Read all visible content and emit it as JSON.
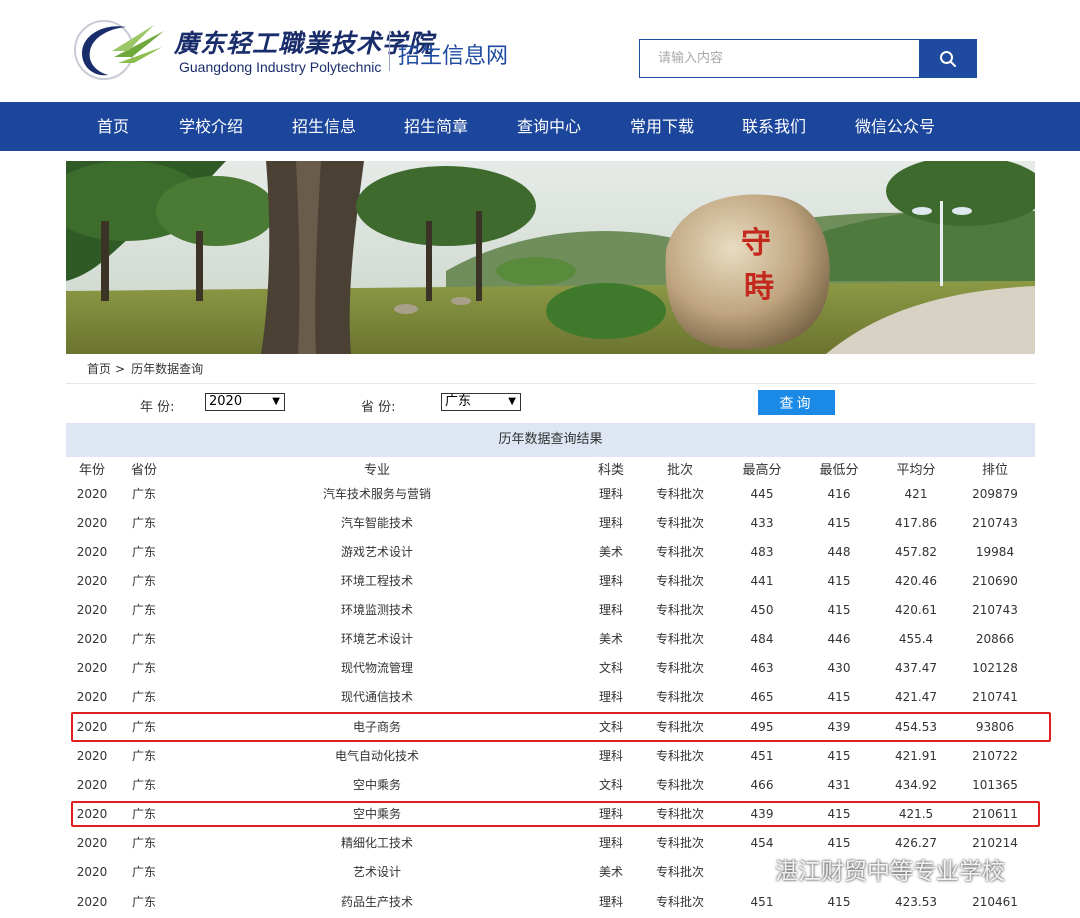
{
  "header": {
    "logo_cn": "廣东轻工職業技术学院",
    "logo_en": "Guangdong Industry Polytechnic",
    "site_name": "招生信息网",
    "search_placeholder": "请输入内容",
    "search_icon": "search-icon",
    "accent": "#1e4aa0"
  },
  "nav": {
    "items": [
      "首页",
      "学校介绍",
      "招生信息",
      "招生简章",
      "查询中心",
      "常用下载",
      "联系我们",
      "微信公众号"
    ],
    "bg": "#1b469c"
  },
  "banner": {
    "stone_text_1": "守",
    "stone_text_2": "時"
  },
  "breadcrumb": {
    "home": "首页",
    "separator": ">",
    "current": "历年数据查询"
  },
  "filters": {
    "year_label": "年  份:",
    "year_value": "2020",
    "province_label": "省  份:",
    "province_value": "广东",
    "query_button": "查询"
  },
  "results": {
    "title": "历年数据查询结果",
    "columns": [
      "年份",
      "省份",
      "专业",
      "科类",
      "批次",
      "最高分",
      "最低分",
      "平均分",
      "排位"
    ],
    "rows": [
      [
        "2020",
        "广东",
        "汽车技术服务与营销",
        "理科",
        "专科批次",
        "445",
        "416",
        "421",
        "209879"
      ],
      [
        "2020",
        "广东",
        "汽车智能技术",
        "理科",
        "专科批次",
        "433",
        "415",
        "417.86",
        "210743"
      ],
      [
        "2020",
        "广东",
        "游戏艺术设计",
        "美术",
        "专科批次",
        "483",
        "448",
        "457.82",
        "19984"
      ],
      [
        "2020",
        "广东",
        "环境工程技术",
        "理科",
        "专科批次",
        "441",
        "415",
        "420.46",
        "210690"
      ],
      [
        "2020",
        "广东",
        "环境监测技术",
        "理科",
        "专科批次",
        "450",
        "415",
        "420.61",
        "210743"
      ],
      [
        "2020",
        "广东",
        "环境艺术设计",
        "美术",
        "专科批次",
        "484",
        "446",
        "455.4",
        "20866"
      ],
      [
        "2020",
        "广东",
        "现代物流管理",
        "文科",
        "专科批次",
        "463",
        "430",
        "437.47",
        "102128"
      ],
      [
        "2020",
        "广东",
        "现代通信技术",
        "理科",
        "专科批次",
        "465",
        "415",
        "421.47",
        "210741"
      ],
      [
        "2020",
        "广东",
        "电子商务",
        "文科",
        "专科批次",
        "495",
        "439",
        "454.53",
        "93806"
      ],
      [
        "2020",
        "广东",
        "电气自动化技术",
        "理科",
        "专科批次",
        "451",
        "415",
        "421.91",
        "210722"
      ],
      [
        "2020",
        "广东",
        "空中乘务",
        "文科",
        "专科批次",
        "466",
        "431",
        "434.92",
        "101365"
      ],
      [
        "2020",
        "广东",
        "空中乘务",
        "理科",
        "专科批次",
        "439",
        "415",
        "421.5",
        "210611"
      ],
      [
        "2020",
        "广东",
        "精细化工技术",
        "理科",
        "专科批次",
        "454",
        "415",
        "426.27",
        "210214"
      ],
      [
        "2020",
        "广东",
        "艺术设计",
        "美术",
        "专科批次",
        "",
        "",
        "",
        ""
      ],
      [
        "2020",
        "广东",
        "药品生产技术",
        "理科",
        "专科批次",
        "451",
        "415",
        "423.53",
        "210461"
      ]
    ],
    "highlight_color": "#e02020"
  },
  "watermark": {
    "text": "湛江财贸中等专业学校",
    "icon": "wechat-icon"
  }
}
